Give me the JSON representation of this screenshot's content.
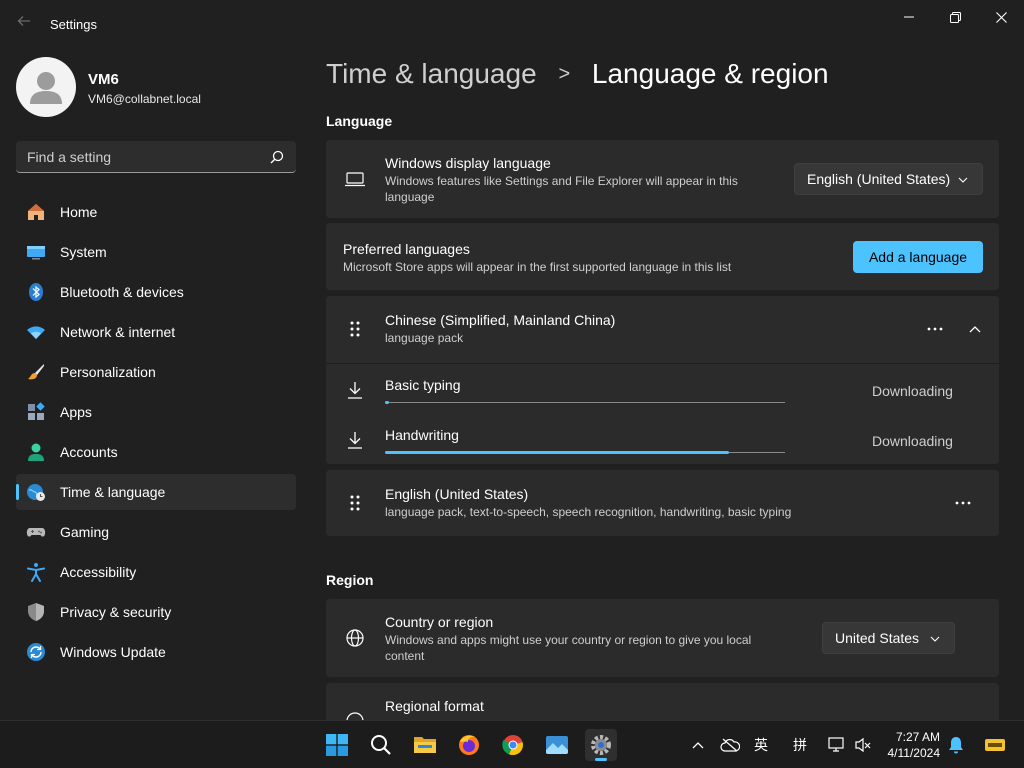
{
  "window": {
    "title": "Settings"
  },
  "profile": {
    "name": "VM6",
    "email": "VM6@collabnet.local"
  },
  "search": {
    "placeholder": "Find a setting"
  },
  "nav": [
    {
      "label": "Home",
      "icon": "home-icon"
    },
    {
      "label": "System",
      "icon": "system-icon"
    },
    {
      "label": "Bluetooth & devices",
      "icon": "bluetooth-icon"
    },
    {
      "label": "Network & internet",
      "icon": "wifi-icon"
    },
    {
      "label": "Personalization",
      "icon": "brush-icon"
    },
    {
      "label": "Apps",
      "icon": "apps-icon"
    },
    {
      "label": "Accounts",
      "icon": "accounts-icon"
    },
    {
      "label": "Time & language",
      "icon": "globe-clock-icon",
      "active": true
    },
    {
      "label": "Gaming",
      "icon": "gamepad-icon"
    },
    {
      "label": "Accessibility",
      "icon": "accessibility-icon"
    },
    {
      "label": "Privacy & security",
      "icon": "shield-icon"
    },
    {
      "label": "Windows Update",
      "icon": "update-icon"
    }
  ],
  "breadcrumb": {
    "parent": "Time & language",
    "separator": ">",
    "current": "Language & region"
  },
  "language_section": {
    "title": "Language",
    "display_language": {
      "title": "Windows display language",
      "subtitle": "Windows features like Settings and File Explorer will appear in this language",
      "value": "English (United States)"
    },
    "preferred": {
      "title": "Preferred languages",
      "subtitle": "Microsoft Store apps will appear in the first supported language in this list",
      "button": "Add a language"
    },
    "languages": [
      {
        "name": "Chinese (Simplified, Mainland China)",
        "detail": "language pack",
        "expanded": true,
        "features": [
          {
            "name": "Basic typing",
            "status": "Downloading",
            "progress": 0.01
          },
          {
            "name": "Handwriting",
            "status": "Downloading",
            "progress": 0.86
          }
        ]
      },
      {
        "name": "English (United States)",
        "detail": "language pack, text-to-speech, speech recognition, handwriting, basic typing"
      }
    ]
  },
  "region_section": {
    "title": "Region",
    "country": {
      "title": "Country or region",
      "subtitle": "Windows and apps might use your country or region to give you local content",
      "value": "United States"
    },
    "format": {
      "title": "Regional format"
    }
  },
  "taskbar": {
    "apps": [
      "start-icon",
      "search-icon",
      "file-explorer-icon",
      "firefox-icon",
      "chrome-icon",
      "photos-icon",
      "settings-icon"
    ],
    "tray": {
      "ime_lang": "英",
      "ime_mode": "拼"
    },
    "time": "7:27 AM",
    "date": "4/11/2024"
  },
  "colors": {
    "accent": "#4cc2ff",
    "background": "#202020",
    "card": "#2b2b2b"
  }
}
